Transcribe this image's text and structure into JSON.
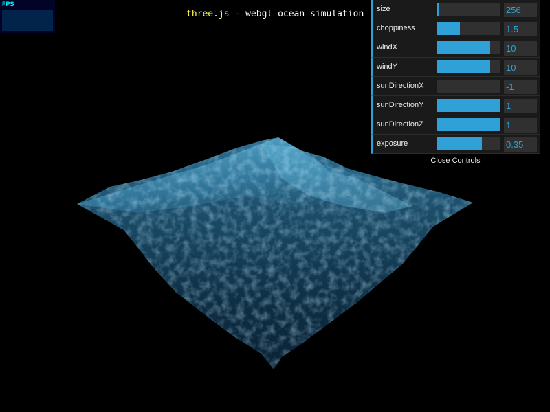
{
  "stats": {
    "label": "FPS"
  },
  "info": {
    "link_text": "three.js",
    "rest_text": " - webgl ocean simulation"
  },
  "gui": {
    "controllers": [
      {
        "label": "size",
        "value": "256",
        "fill": 0.03
      },
      {
        "label": "choppiness",
        "value": "1.5",
        "fill": 0.36
      },
      {
        "label": "windX",
        "value": "10",
        "fill": 0.84
      },
      {
        "label": "windY",
        "value": "10",
        "fill": 0.84
      },
      {
        "label": "sunDirectionX",
        "value": "-1",
        "fill": 0.0
      },
      {
        "label": "sunDirectionY",
        "value": "1",
        "fill": 1.0
      },
      {
        "label": "sunDirectionZ",
        "value": "1",
        "fill": 1.0
      },
      {
        "label": "exposure",
        "value": "0.35",
        "fill": 0.71
      }
    ],
    "close_label": "Close Controls"
  },
  "colors": {
    "accent": "#2fa1d6",
    "panel_bg": "#1a1a1a",
    "field_bg": "#303030",
    "info_link": "#ffff55",
    "fps_text": "#00ffff",
    "fps_bg": "#020326",
    "ocean_dark": "#0b2233",
    "ocean_light": "#5fb6d8"
  }
}
